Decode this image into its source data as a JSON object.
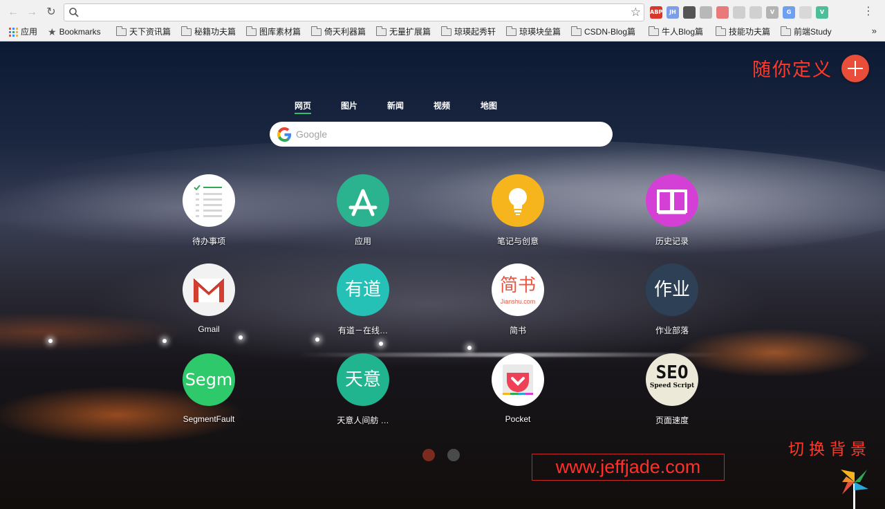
{
  "browser": {
    "address_value": "",
    "bookmarks": [
      {
        "label": "应用",
        "kind": "apps"
      },
      {
        "label": "Bookmarks",
        "kind": "star"
      },
      {
        "label": "天下资讯篇",
        "kind": "folder"
      },
      {
        "label": "秘籍功夫篇",
        "kind": "folder"
      },
      {
        "label": "图库素材篇",
        "kind": "folder"
      },
      {
        "label": "倚天利器篇",
        "kind": "folder"
      },
      {
        "label": "无量扩展篇",
        "kind": "folder"
      },
      {
        "label": "琼瑛起秀轩",
        "kind": "folder"
      },
      {
        "label": "琼瑛块垒篇",
        "kind": "folder"
      },
      {
        "label": "CSDN-Blog篇",
        "kind": "folder"
      },
      {
        "label": "牛人Blog篇",
        "kind": "folder"
      },
      {
        "label": "技能功夫篇",
        "kind": "folder"
      },
      {
        "label": "前端Study",
        "kind": "folder"
      }
    ],
    "more_bookmarks": "»",
    "extensions": [
      {
        "name": "adblock-plus-icon",
        "text": "ABP",
        "color": "#d9372c"
      },
      {
        "name": "jh-icon",
        "text": "JH",
        "color": "#7b9ee6"
      },
      {
        "name": "qr-code-icon",
        "text": "",
        "color": "#555555"
      },
      {
        "name": "gesture-icon",
        "text": "",
        "color": "#b8b8b8"
      },
      {
        "name": "screenshot-icon",
        "text": "",
        "color": "#e97a7a"
      },
      {
        "name": "circle-ext-icon",
        "text": "",
        "color": "#cfcfcf"
      },
      {
        "name": "play-ext-icon",
        "text": "",
        "color": "#d0d0d0"
      },
      {
        "name": "v-ext-icon",
        "text": "V",
        "color": "#b3b3b3"
      },
      {
        "name": "translate-icon",
        "text": "G",
        "color": "#6fa0f0"
      },
      {
        "name": "weibo-icon",
        "text": "",
        "color": "#d8d8d8"
      },
      {
        "name": "vue-devtools-icon",
        "text": "V",
        "color": "#4cbf9a"
      }
    ]
  },
  "newtab": {
    "custom_label": "随你定义",
    "search_tabs": [
      "网页",
      "图片",
      "新闻",
      "视频",
      "地图"
    ],
    "active_tab": "网页",
    "search_placeholder": "Google",
    "tiles": [
      {
        "label": "待办事项",
        "icon": "todo-list-icon",
        "bg": "#ffffff"
      },
      {
        "label": "应用",
        "icon": "app-store-icon",
        "bg": "#2bb28f"
      },
      {
        "label": "笔记与创意",
        "icon": "lightbulb-icon",
        "bg": "#f6b51d"
      },
      {
        "label": "历史记录",
        "icon": "book-icon",
        "bg": "#d43fd6"
      },
      {
        "label": "Gmail",
        "icon": "gmail-icon",
        "bg": "#f2f2f2"
      },
      {
        "label": "有道－在线…",
        "icon": "youdao-icon",
        "icon_text": "有道",
        "bg": "#26c1b6"
      },
      {
        "label": "简书",
        "icon": "jianshu-icon",
        "icon_text": "简书",
        "icon_sub": "Jianshu.com",
        "bg": "#ffffff"
      },
      {
        "label": "作业部落",
        "icon": "zybuluo-icon",
        "icon_text": "作业",
        "bg": "#2e4055"
      },
      {
        "label": "SegmentFault",
        "icon": "segmentfault-icon",
        "icon_text": "Segm",
        "bg": "#2ec96b"
      },
      {
        "label": "天意人间舫 …",
        "icon": "tianyi-icon",
        "icon_text": "天意",
        "bg": "#21b58f"
      },
      {
        "label": "Pocket",
        "icon": "pocket-icon",
        "bg": "#ffffff"
      },
      {
        "label": "页面速度",
        "icon": "seo-speed-icon",
        "icon_text": "SEO",
        "icon_sub": "Speed Script",
        "bg": "#ece9d8"
      }
    ],
    "pages": [
      {
        "color": "#7a2a1e",
        "active": true
      },
      {
        "color": "#4a4a4a",
        "active": false
      }
    ],
    "bg_switch_label": "切换背景",
    "watermark": "www.jeffjade.com"
  }
}
